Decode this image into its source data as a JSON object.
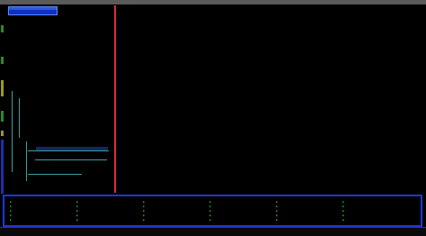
{
  "window": {
    "title": ""
  },
  "popup": {
    "items": [
      "",
      "",
      ""
    ]
  },
  "editor": {
    "lines": [
      {
        "t": "",
        "cls": "c-cyan"
      },
      {
        "t": "",
        "cls": "c-cyan"
      },
      {
        "t": "",
        "cls": "c-cyan"
      },
      {
        "t": "",
        "cls": "c-cyan"
      },
      {
        "t": "",
        "cls": "c-white"
      },
      {
        "t": "",
        "cls": "c-white"
      },
      {
        "t": "",
        "cls": "c-green"
      },
      {
        "t": "",
        "cls": "c-green"
      },
      {
        "t": "",
        "cls": "c-cyan"
      },
      {
        "t": "",
        "cls": "c-white"
      },
      {
        "t": "",
        "cls": "c-green"
      },
      {
        "t": "",
        "cls": "c-green"
      },
      {
        "t": "",
        "cls": "c-cyan"
      }
    ]
  },
  "bottom_panel": {
    "items": [
      "",
      "",
      "",
      "",
      "",
      "",
      "",
      "",
      "",
      "",
      "",
      "",
      "",
      "",
      "",
      "",
      "",
      "",
      "",
      "",
      "",
      "",
      "",
      "",
      "",
      "",
      "",
      "",
      "",
      ""
    ]
  },
  "statusbar": {
    "mode": "",
    "message": "",
    "position": "",
    "encoding": "",
    "percent": ""
  }
}
